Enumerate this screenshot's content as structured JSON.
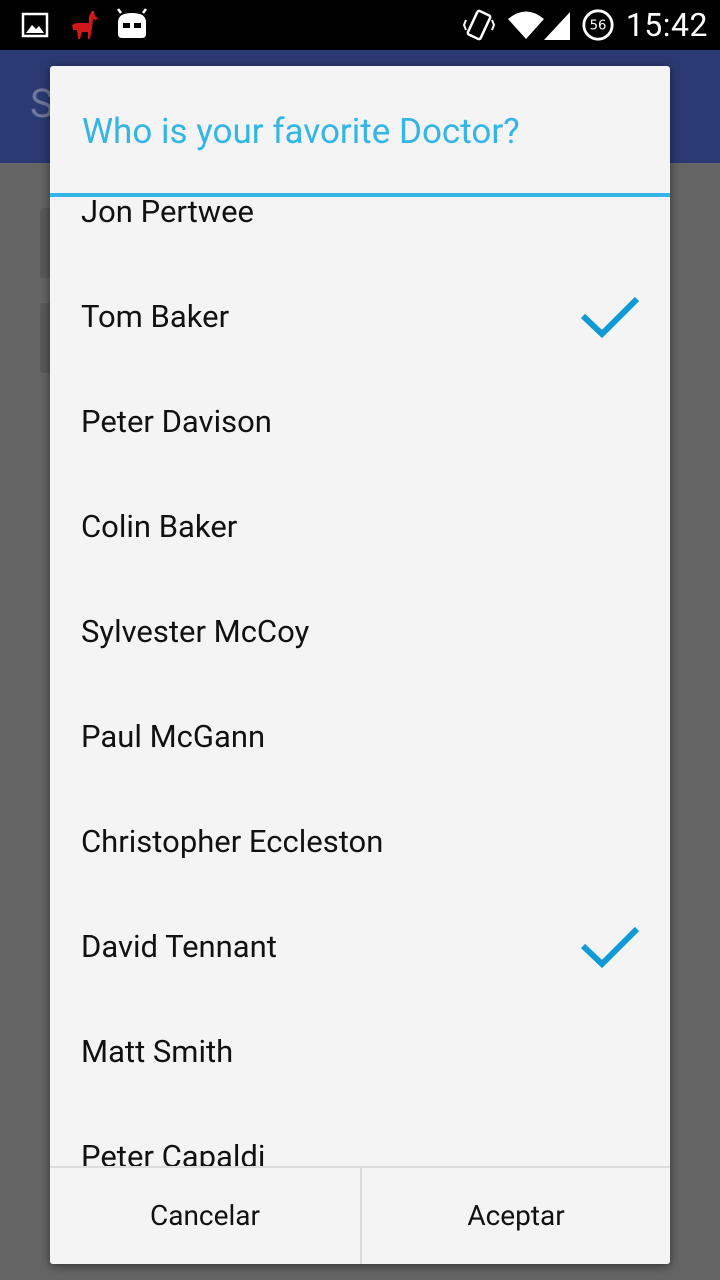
{
  "status_bar": {
    "time": "15:42",
    "battery_level": "56",
    "icons": [
      "gallery-icon",
      "llama-icon",
      "cyanogen-mod-icon",
      "vibrate-icon",
      "wifi-icon",
      "signal-icon",
      "battery-icon"
    ]
  },
  "app": {
    "title": "S"
  },
  "dialog": {
    "title": "Who is your favorite Doctor?",
    "accent_color": "#33b5e5",
    "check_color": "#0e9ad7",
    "items": [
      {
        "label": "Jon Pertwee",
        "checked": false
      },
      {
        "label": "Tom Baker",
        "checked": true
      },
      {
        "label": "Peter Davison",
        "checked": false
      },
      {
        "label": "Colin Baker",
        "checked": false
      },
      {
        "label": "Sylvester McCoy",
        "checked": false
      },
      {
        "label": "Paul McGann",
        "checked": false
      },
      {
        "label": "Christopher Eccleston",
        "checked": false
      },
      {
        "label": "David Tennant",
        "checked": true
      },
      {
        "label": "Matt Smith",
        "checked": false
      },
      {
        "label": "Peter Capaldi",
        "checked": false
      }
    ],
    "cancel_label": "Cancelar",
    "accept_label": "Aceptar"
  }
}
